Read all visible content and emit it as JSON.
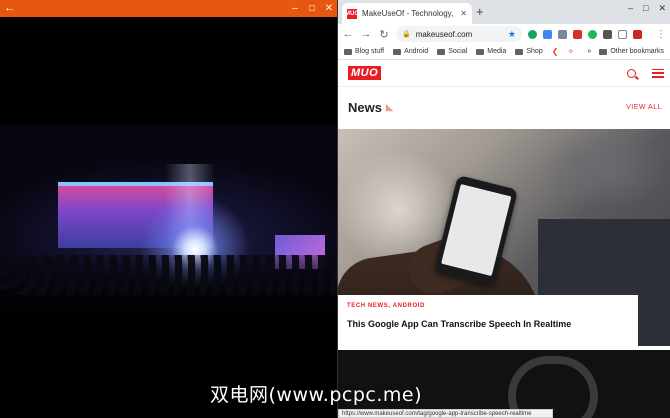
{
  "left_window": {
    "back_glyph": "←",
    "minimize_glyph": "–",
    "maximize_glyph": "□",
    "close_glyph": "✕",
    "titlebar_color": "#e8570f"
  },
  "browser": {
    "tab": {
      "title": "MakeUseOf - Technology, Simplif",
      "favicon_text": "MUO",
      "close_glyph": "✕"
    },
    "new_tab_glyph": "+",
    "window_controls": [
      "–",
      "□",
      "✕"
    ],
    "toolbar": {
      "back": "←",
      "forward": "→",
      "reload": "↻",
      "lock": "🔒",
      "url": "makeuseof.com",
      "star": "★",
      "menu": "⋮"
    },
    "bookmarks": [
      {
        "label": "Blog stuff"
      },
      {
        "label": "Android"
      },
      {
        "label": "Social"
      },
      {
        "label": "Media"
      },
      {
        "label": "Shop"
      }
    ],
    "bookmarks_more": "»",
    "other_bookmarks": "Other bookmarks",
    "status_url": "https://www.makeuseof.com/tag/google-app-transcribe-speech-realtime"
  },
  "site": {
    "logo": "MUO",
    "accent": "#e81e25",
    "section_title": "News",
    "view_all": "VIEW ALL",
    "featured": {
      "tags": "TECH NEWS, ANDROID",
      "title": "This Google App Can Transcribe Speech In Realtime"
    }
  },
  "watermark": "双电网(www.pcpc.me)"
}
